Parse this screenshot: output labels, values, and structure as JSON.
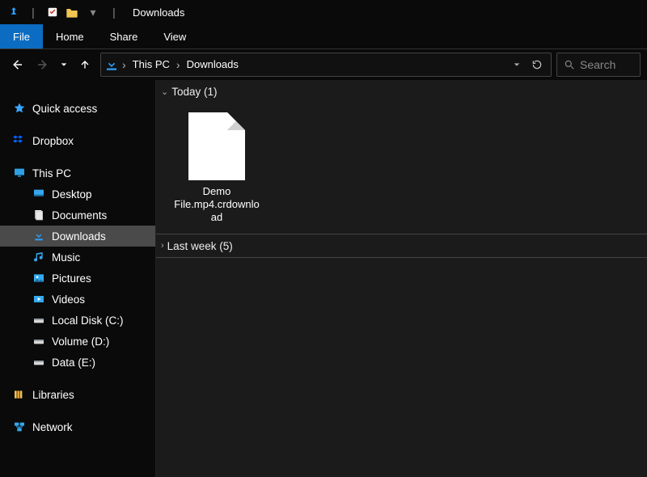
{
  "window": {
    "title": "Downloads"
  },
  "ribbon": {
    "file": "File",
    "home": "Home",
    "share": "Share",
    "view": "View"
  },
  "address": {
    "root": "This PC",
    "folder": "Downloads"
  },
  "search": {
    "placeholder": "Search"
  },
  "sidebar": {
    "quick_access": "Quick access",
    "dropbox": "Dropbox",
    "this_pc": "This PC",
    "desktop": "Desktop",
    "documents": "Documents",
    "downloads": "Downloads",
    "music": "Music",
    "pictures": "Pictures",
    "videos": "Videos",
    "local_c": "Local Disk (C:)",
    "volume_d": "Volume (D:)",
    "data_e": "Data (E:)",
    "libraries": "Libraries",
    "network": "Network"
  },
  "content": {
    "groups": {
      "today": {
        "label": "Today (1)",
        "files": [
          {
            "name": "Demo File.mp4.crdownload"
          }
        ]
      },
      "last_week": {
        "label": "Last week (5)"
      }
    }
  },
  "colors": {
    "accent": "#0b6cc1",
    "selected_bg": "#4a4a4a",
    "content_bg": "#1b1b1b"
  }
}
